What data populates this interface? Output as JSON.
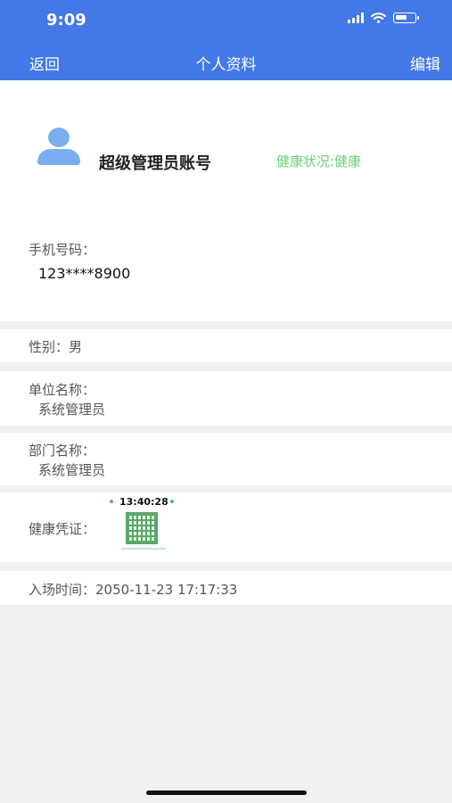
{
  "status_bar": {
    "time": "9:09"
  },
  "nav": {
    "back_label": "返回",
    "title": "个人资料",
    "edit_label": "编辑"
  },
  "profile": {
    "account_name": "超级管理员账号",
    "health_status": "健康状况:健康",
    "phone_label": "手机号码：",
    "phone_value": "123****8900"
  },
  "rows": {
    "gender": "性别：男",
    "unit_label": "单位名称：",
    "unit_value": "系统管理员",
    "department_label": "部门名称：",
    "department_value": "系统管理员",
    "health_code_label": "健康凭证：",
    "health_code_time": "13:40:28",
    "entry_time": "入场时间：2050-11-23 17:17:33"
  },
  "colors": {
    "header": "#4478e6",
    "health_green": "#67d17a",
    "background": "#f1f1f1"
  }
}
